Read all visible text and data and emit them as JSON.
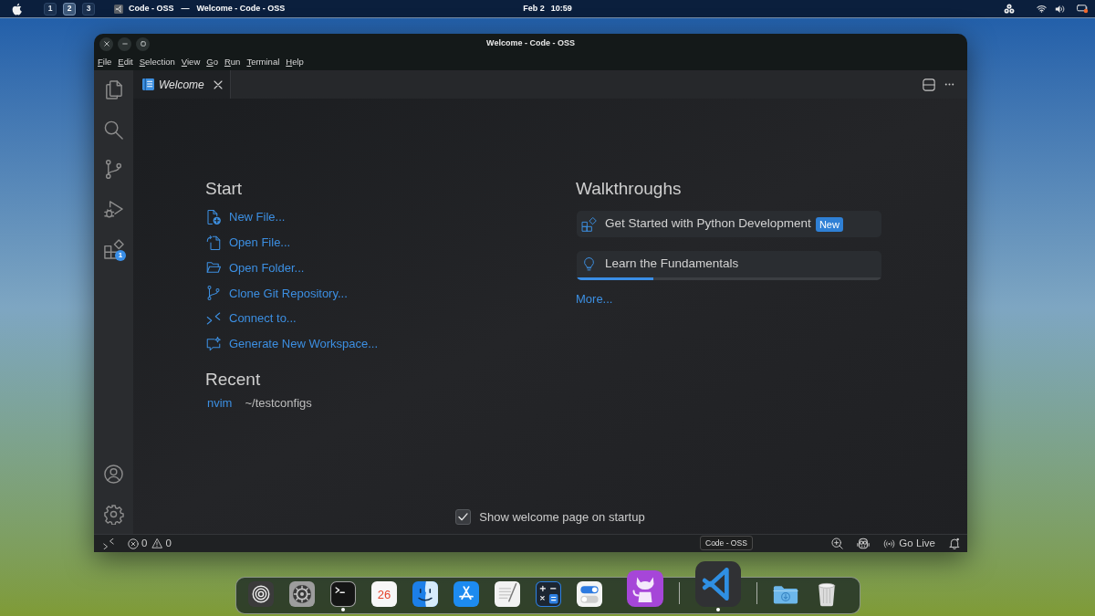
{
  "top_bar": {
    "workspaces": [
      {
        "label": "1",
        "selected": false
      },
      {
        "label": "2",
        "selected": true
      },
      {
        "label": "3",
        "selected": false
      }
    ],
    "app_name": "Code - OSS",
    "separator": "—",
    "window_title": "Welcome - Code - OSS",
    "date": "Feb 2",
    "time": "10:59"
  },
  "window": {
    "title": "Welcome - Code - OSS",
    "menu": [
      "File",
      "Edit",
      "Selection",
      "View",
      "Go",
      "Run",
      "Terminal",
      "Help"
    ]
  },
  "activity_bar": {
    "extensions_badge": "1"
  },
  "editor": {
    "tabs": [
      {
        "label": "Welcome",
        "selected": true
      }
    ]
  },
  "welcome": {
    "start": {
      "title": "Start",
      "items": [
        {
          "kind": "newfile",
          "label": "New File..."
        },
        {
          "kind": "openfile",
          "label": "Open File..."
        },
        {
          "kind": "folder",
          "label": "Open Folder..."
        },
        {
          "kind": "clone",
          "label": "Clone Git Repository..."
        },
        {
          "kind": "connect",
          "label": "Connect to..."
        },
        {
          "kind": "generate",
          "label": "Generate New Workspace..."
        }
      ]
    },
    "recent": {
      "title": "Recent",
      "items": [
        {
          "name": "nvim",
          "path": "~/testconfigs"
        }
      ]
    },
    "walkthroughs": {
      "title": "Walkthroughs",
      "items": [
        {
          "kind": "python",
          "label": "Get Started with Python Development",
          "badge": "New"
        },
        {
          "kind": "fundamentals",
          "label": "Learn the Fundamentals",
          "level": 0.25
        }
      ],
      "more": "More..."
    },
    "show_on_startup": {
      "label": "Show welcome page on startup",
      "checked": true
    }
  },
  "status_bar": {
    "errors": "0",
    "warnings": "0",
    "go_live": "Go Live"
  },
  "dock": {
    "sections": [
      {
        "items": [
          {
            "kind": "launcher",
            "running": false,
            "hovered": false
          },
          {
            "kind": "settings",
            "running": false,
            "hovered": false
          },
          {
            "kind": "terminal",
            "running": true,
            "hovered": false
          },
          {
            "kind": "calendar",
            "label": "26",
            "running": false,
            "hovered": false
          },
          {
            "kind": "finder",
            "running": false,
            "hovered": false
          },
          {
            "kind": "appstore",
            "running": false,
            "hovered": false
          },
          {
            "kind": "notes",
            "running": false,
            "hovered": false
          },
          {
            "kind": "calculator",
            "running": false,
            "hovered": false
          },
          {
            "kind": "toggles",
            "running": false,
            "hovered": false
          },
          {
            "kind": "github",
            "running": false,
            "hovered": false
          }
        ]
      },
      {
        "items": [
          {
            "kind": "vscode",
            "running": true,
            "hovered": true
          }
        ]
      },
      {
        "items": [
          {
            "kind": "downloads",
            "running": false,
            "hovered": false
          },
          {
            "kind": "trash",
            "running": false,
            "hovered": false
          }
        ]
      }
    ],
    "tooltip": "Code - OSS"
  }
}
